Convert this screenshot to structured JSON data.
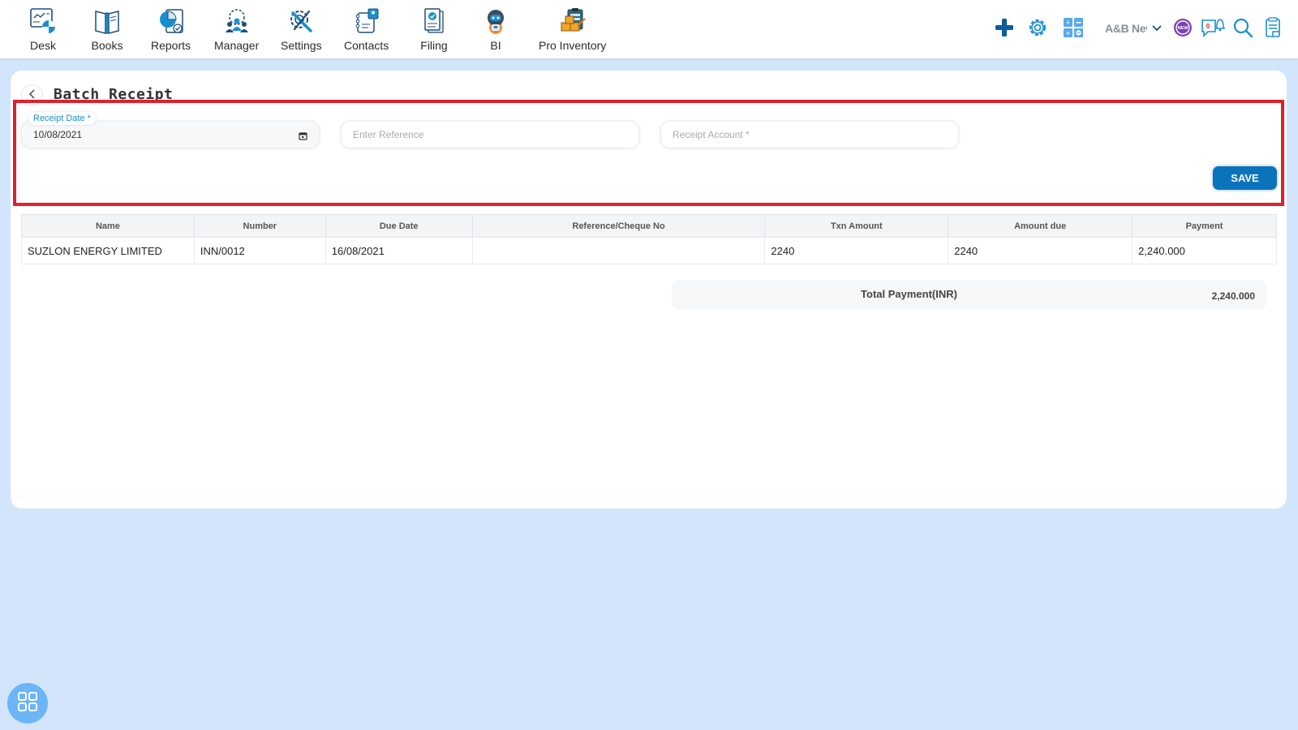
{
  "nav": {
    "items": [
      {
        "label": "Desk",
        "icon": "desk-icon"
      },
      {
        "label": "Books",
        "icon": "books-icon"
      },
      {
        "label": "Reports",
        "icon": "reports-icon"
      },
      {
        "label": "Manager",
        "icon": "manager-icon"
      },
      {
        "label": "Settings",
        "icon": "settings-icon"
      },
      {
        "label": "Contacts",
        "icon": "contacts-icon"
      },
      {
        "label": "Filing",
        "icon": "filing-icon"
      },
      {
        "label": "BI",
        "icon": "bi-robot-icon"
      },
      {
        "label": "Pro Inventory",
        "icon": "pro-inventory-icon"
      }
    ]
  },
  "tools": {
    "company_name": "A&B New",
    "notification_count": "0",
    "badge_new": "NEW"
  },
  "page": {
    "title": "Batch Receipt"
  },
  "form": {
    "receipt_date_label": "Receipt Date *",
    "receipt_date_value": "10/08/2021",
    "reference_placeholder": "Enter Reference",
    "receipt_account_placeholder": "Receipt Account *",
    "save_label": "SAVE"
  },
  "table": {
    "columns": [
      "Name",
      "Number",
      "Due Date",
      "Reference/Cheque No",
      "Txn Amount",
      "Amount due",
      "Payment"
    ],
    "rows": [
      {
        "name": "SUZLON ENERGY LIMITED",
        "number": "INN/0012",
        "due_date": "16/08/2021",
        "reference": "",
        "txn_amount": "2240",
        "amount_due": "2240",
        "payment": "2,240.000"
      }
    ]
  },
  "total": {
    "label": "Total Payment(INR)",
    "value": "2,240.000"
  },
  "colors": {
    "accent": "#0b73bb",
    "highlight": "#e0202a",
    "background": "#d3e5fb",
    "label_blue": "#1a8fd0"
  }
}
